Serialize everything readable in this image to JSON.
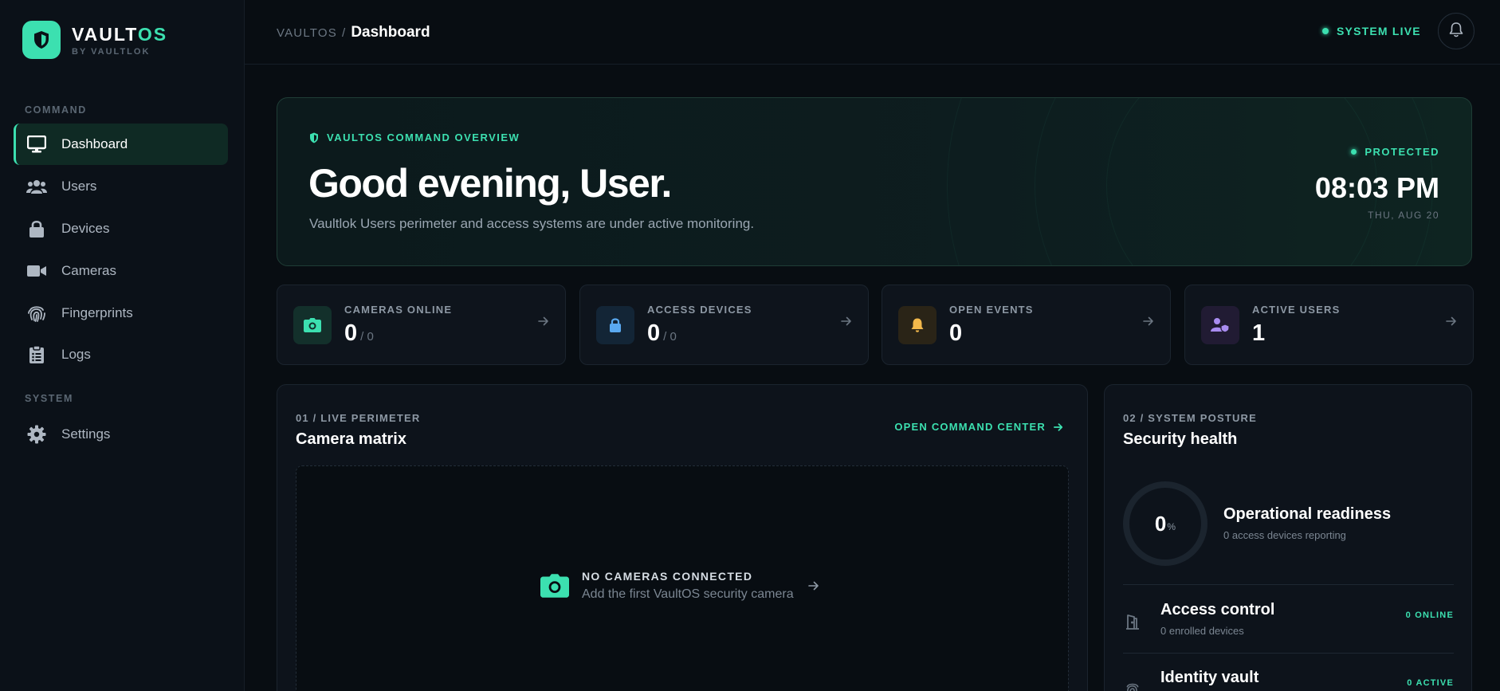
{
  "brand": {
    "name_main": "VAULT",
    "name_accent": "OS",
    "sub": "BY VAULTLOK",
    "logo_icon": "shield-icon",
    "accent_color": "#3ce0b0"
  },
  "sidebar": {
    "sections": [
      {
        "title": "COMMAND"
      },
      {
        "title": "SYSTEM"
      }
    ],
    "items": [
      {
        "label": "Dashboard",
        "icon": "monitor-icon",
        "active": true
      },
      {
        "label": "Users",
        "icon": "users-icon"
      },
      {
        "label": "Devices",
        "icon": "lock-icon"
      },
      {
        "label": "Cameras",
        "icon": "video-camera-icon"
      },
      {
        "label": "Fingerprints",
        "icon": "fingerprint-icon"
      },
      {
        "label": "Logs",
        "icon": "clipboard-list-icon"
      },
      {
        "label": "Settings",
        "icon": "gear-icon"
      }
    ]
  },
  "topbar": {
    "breadcrumb_root": "VAULTOS",
    "breadcrumb_sep": "/",
    "breadcrumb_current": "Dashboard",
    "status_text": "SYSTEM LIVE",
    "notifications_icon": "bell-icon"
  },
  "hero": {
    "kicker": "VAULTOS COMMAND OVERVIEW",
    "greeting": "Good evening, User.",
    "description": "Vaultlok Users perimeter and access systems are under active monitoring.",
    "status": "PROTECTED",
    "time": "08:03 PM",
    "date": "THU, AUG 20"
  },
  "stats": [
    {
      "label": "CAMERAS ONLINE",
      "value": "0",
      "denominator": "/ 0",
      "icon": "camera-icon",
      "color": "#3ce0b0"
    },
    {
      "label": "ACCESS DEVICES",
      "value": "0",
      "denominator": "/ 0",
      "icon": "lock-icon",
      "color": "#5aa9f0"
    },
    {
      "label": "OPEN EVENTS",
      "value": "0",
      "denominator": "",
      "icon": "bell-icon",
      "color": "#f2b84b"
    },
    {
      "label": "ACTIVE USERS",
      "value": "1",
      "denominator": "",
      "icon": "user-shield-icon",
      "color": "#a98cf0"
    }
  ],
  "camera_panel": {
    "kicker": "01 / LIVE PERIMETER",
    "title": "Camera matrix",
    "action": "OPEN COMMAND CENTER",
    "empty_title": "NO CAMERAS CONNECTED",
    "empty_sub": "Add the first VaultOS security camera"
  },
  "health_panel": {
    "kicker": "02 / SYSTEM POSTURE",
    "title": "Security health",
    "gauge_value": "0",
    "gauge_unit": "%",
    "readiness_title": "Operational readiness",
    "readiness_sub": "0 access devices reporting",
    "rows": [
      {
        "title": "Access control",
        "sub": "0 enrolled devices",
        "badge": "0 ONLINE",
        "icon": "door-icon"
      },
      {
        "title": "Identity vault",
        "sub": "",
        "badge": "0 ACTIVE",
        "icon": "fingerprint-icon"
      }
    ]
  }
}
